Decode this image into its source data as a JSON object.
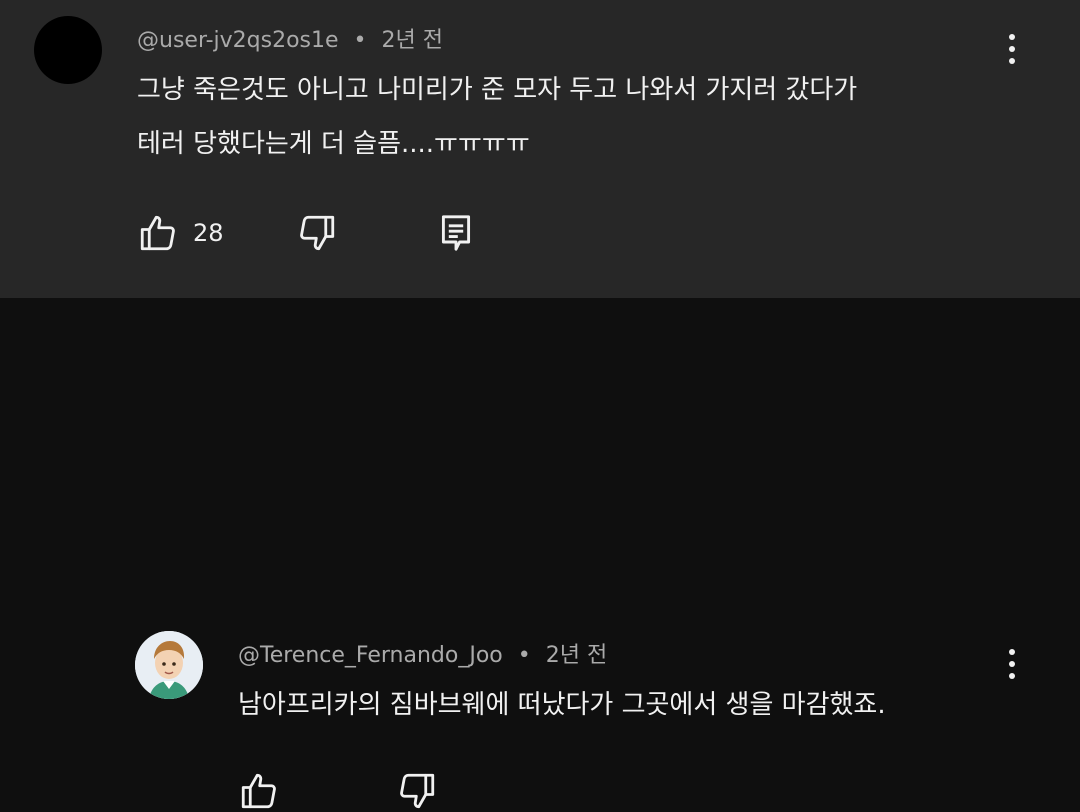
{
  "comments": [
    {
      "author": "@user-jv2qs2os1e",
      "separator": "•",
      "time": "2년 전",
      "text_lines": [
        "그냥 죽은것도 아니고 나미리가 준 모자 두고 나와서 가지러 갔다가",
        "테러 당했다는게 더 슬픔....ㅠㅠㅠㅠ"
      ],
      "like_count": "28",
      "avatar_color": "#000000",
      "icons": [
        "more-vert-icon",
        "thumb-up-icon",
        "thumb-down-icon",
        "reply-icon"
      ]
    },
    {
      "author": "@Terence_Fernando_Joo",
      "separator": "•",
      "time": "2년 전",
      "text_lines": [
        "남아프리카의 짐바브웨에 떠났다가 그곳에서 생을 마감했죠."
      ],
      "avatar_color": "#e8eef4",
      "icons": [
        "more-vert-icon",
        "thumb-up-icon",
        "thumb-down-icon"
      ]
    }
  ],
  "colors": {
    "highlight_bg": "#272727",
    "page_bg": "#0f0f0f",
    "text_primary": "#f1f1f1",
    "text_secondary": "#aaaaaa"
  }
}
